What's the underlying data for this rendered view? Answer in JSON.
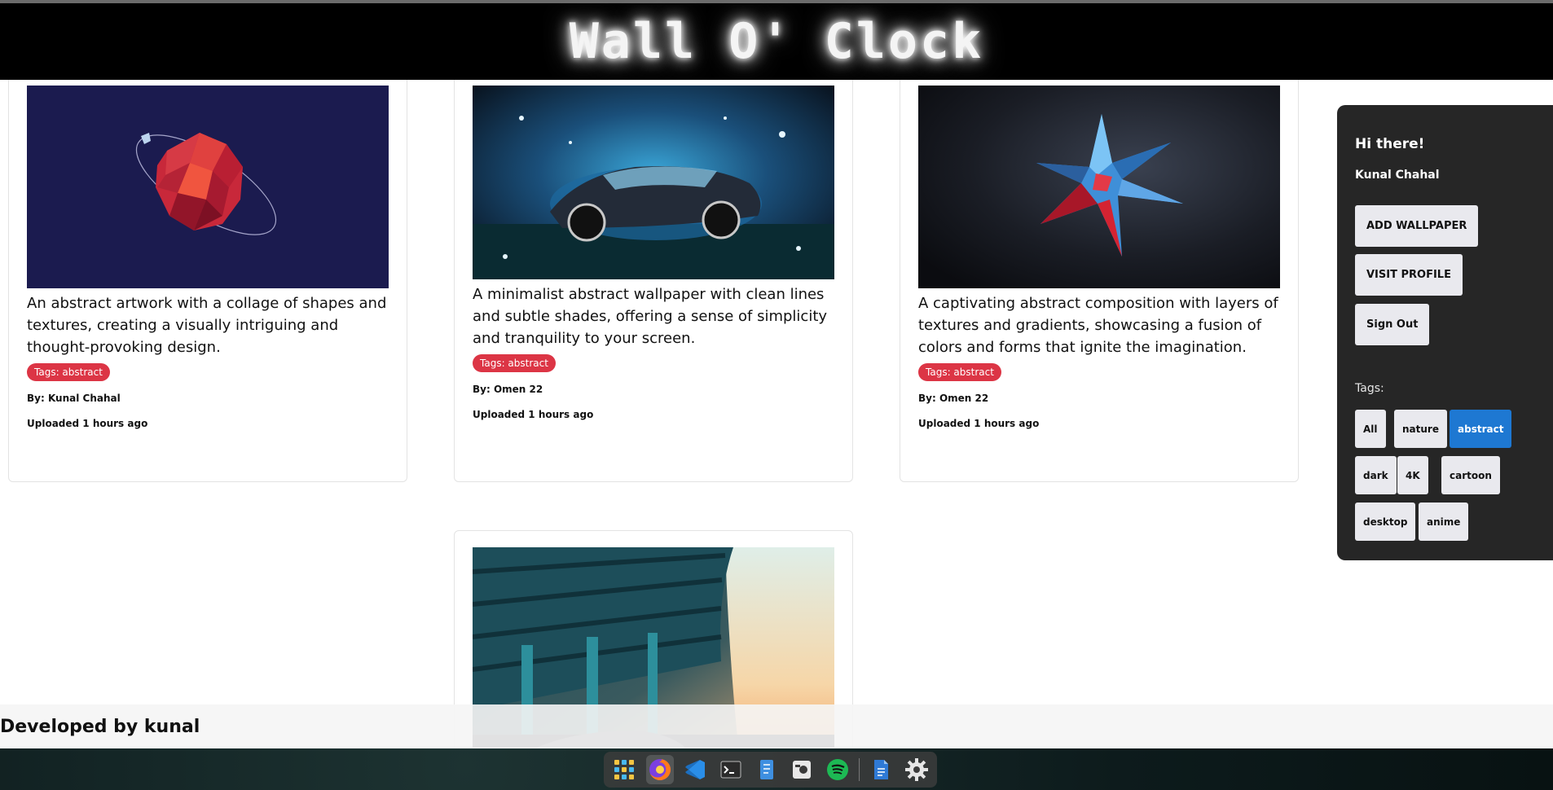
{
  "header": {
    "title": "Wall O' Clock"
  },
  "wallpapers": [
    {
      "description": "An abstract artwork with a collage of shapes and textures, creating a visually intriguing and thought-provoking design.",
      "tag": "Tags: abstract",
      "author": "By: Kunal Chahal",
      "uploaded": "Uploaded 1 hours ago",
      "image": "low-poly-red-planet"
    },
    {
      "description": "A minimalist abstract wallpaper with clean lines and subtle shades, offering a sense of simplicity and tranquility to your screen.",
      "tag": "Tags: abstract",
      "author": "By: Omen 22",
      "uploaded": "Uploaded 1 hours ago",
      "image": "water-splash-car"
    },
    {
      "description": "A captivating abstract composition with layers of textures and gradients, showcasing a fusion of colors and forms that ignite the imagination.",
      "tag": "Tags: abstract",
      "author": "By: Omen 22",
      "uploaded": "Uploaded 1 hours ago",
      "image": "blue-red-spiky-star"
    },
    {
      "image": "car-under-bridge-sunset"
    }
  ],
  "sidebar": {
    "greeting": "Hi there!",
    "user_name": "Kunal Chahal",
    "add_wallpaper": "ADD WALLPAPER",
    "visit_profile": "VISIT PROFILE",
    "sign_out": "Sign Out",
    "tags_label": "Tags:",
    "tags": [
      "All",
      "nature",
      "abstract",
      "dark",
      "4K",
      "cartoon",
      "desktop",
      "anime"
    ],
    "active_tag": "abstract",
    "accent_color": "#1e78d2"
  },
  "footer": {
    "text": "Developed by kunal"
  },
  "dock": {
    "apps": [
      "app-grid-icon",
      "firefox-icon",
      "vscode-icon",
      "terminal-icon",
      "text-editor-icon",
      "screenshot-icon",
      "spotify-icon",
      "document-icon",
      "settings-icon"
    ],
    "active_app": "firefox-icon"
  }
}
